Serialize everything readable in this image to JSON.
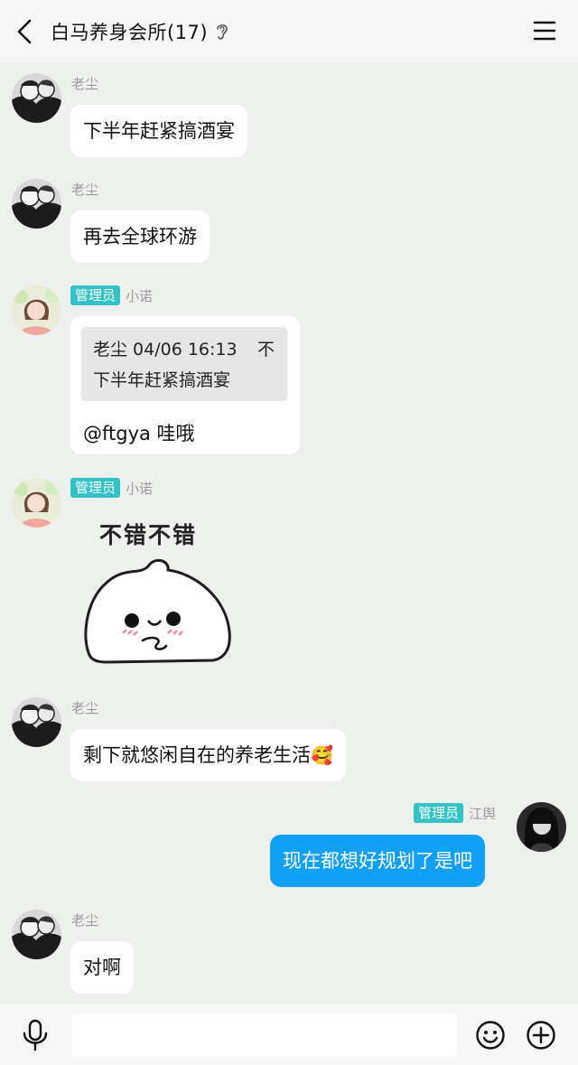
{
  "header": {
    "title": "白马养身会所(17)"
  },
  "messages": [
    {
      "sender": "老尘",
      "text": "下半年赶紧搞酒宴"
    },
    {
      "sender": "老尘",
      "text": "再去全球环游"
    },
    {
      "sender": "小诺",
      "badge": "管理员",
      "quote_meta": "老尘 04/06 16:13",
      "quote_pin": "不",
      "quote_text": "下半年赶紧搞酒宴",
      "text": "@ftgya 哇哦"
    },
    {
      "sender": "小诺",
      "badge": "管理员",
      "sticker_text": "不错不错"
    },
    {
      "sender": "老尘",
      "text": "剩下就悠闲自在的养老生活",
      "emoji": "🥰"
    },
    {
      "sender": "江舆",
      "badge": "管理员",
      "text": "现在都想好规划了是吧"
    },
    {
      "sender": "老尘",
      "text": "对啊"
    }
  ],
  "icons": {
    "back": "back-arrow-icon",
    "ear": "ear-icon",
    "menu": "menu-icon",
    "mic": "microphone-icon",
    "emoji": "emoji-icon",
    "plus": "plus-icon"
  },
  "colors": {
    "chat_bg": "#eef0ed",
    "my_bubble": "#12a0f7",
    "admin_badge": "#35c2c6"
  }
}
